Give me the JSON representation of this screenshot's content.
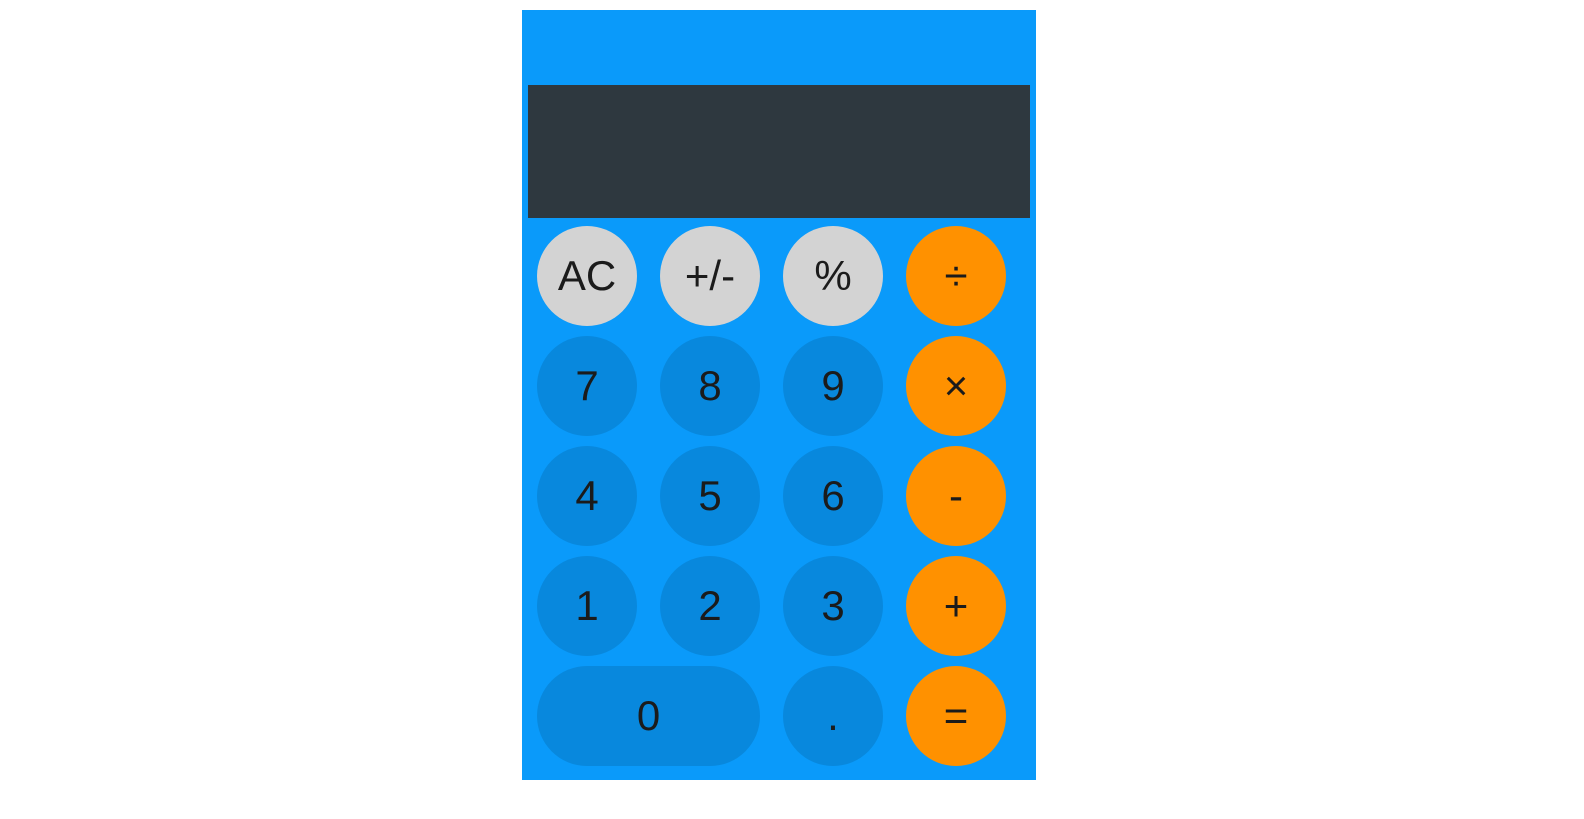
{
  "colors": {
    "frame": "#0a9afa",
    "display": "#2e383f",
    "number_key": "#0888dd",
    "function_key": "#d3d3d3",
    "operator_key": "#ff9100",
    "key_text": "#1b1b1b"
  },
  "display": {
    "value": ""
  },
  "keys": {
    "clear": "AC",
    "sign": "+/-",
    "percent": "%",
    "divide": "÷",
    "seven": "7",
    "eight": "8",
    "nine": "9",
    "multiply": "×",
    "four": "4",
    "five": "5",
    "six": "6",
    "subtract": "-",
    "one": "1",
    "two": "2",
    "three": "3",
    "add": "+",
    "zero": "0",
    "decimal": ".",
    "equals": "="
  }
}
